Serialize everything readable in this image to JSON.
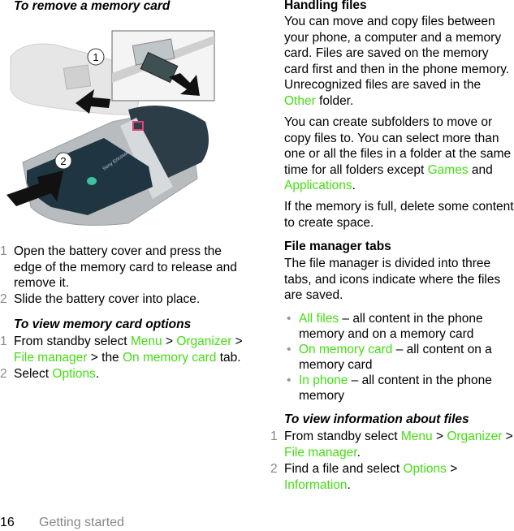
{
  "left": {
    "heading1": "To remove a memory card",
    "illustration": {
      "callout1": "1",
      "callout2": "2",
      "brand_text": "Sony Ericsson"
    },
    "steps1": [
      {
        "num": "1",
        "text": "Open the battery cover and press the edge of the memory card to release and remove it."
      },
      {
        "num": "2",
        "text": "Slide the battery cover into place."
      }
    ],
    "heading2": "To view memory card options",
    "steps2": [
      {
        "num": "1",
        "pre": "From standby select ",
        "l1": "Menu",
        "s1": " > ",
        "l2": "Organizer",
        "s2": " > ",
        "l3": "File manager",
        "s3": " > the ",
        "l4": "On memory card",
        "post": " tab."
      },
      {
        "num": "2",
        "pre": "Select ",
        "l1": "Options",
        "post": "."
      }
    ]
  },
  "right": {
    "heading1": "Handling files",
    "p1": {
      "pre": "You can move and copy files between your phone, a computer and a memory card. Files are saved on the memory card first and then in the phone memory. Unrecognized files are saved in the ",
      "link": "Other",
      "post": " folder."
    },
    "p2": {
      "pre": "You can create subfolders to move or copy files to. You can select more than one or all the files in a folder at the same time for all folders except ",
      "l1": "Games",
      "mid": " and ",
      "l2": "Applications",
      "post": "."
    },
    "p3": "If the memory is full, delete some content to create space.",
    "heading2": "File manager tabs",
    "p4": "The file manager is divided into three tabs, and icons indicate where the files are saved.",
    "bullets": [
      {
        "link": "All files",
        "text": " – all content in the phone memory and on a memory card"
      },
      {
        "link": "On memory card",
        "text": " – all content on a memory card"
      },
      {
        "link": "In phone",
        "text": " – all content in the phone memory"
      }
    ],
    "heading3": "To view information about files",
    "steps": [
      {
        "num": "1",
        "pre": "From standby select ",
        "l1": "Menu",
        "s1": " > ",
        "l2": "Organizer",
        "s2": " > ",
        "l3": "File manager",
        "post": "."
      },
      {
        "num": "2",
        "pre": "Find a file and select ",
        "l1": "Options",
        "s1": " > ",
        "l2": "Information",
        "post": "."
      }
    ]
  },
  "footer": {
    "page_number": "16",
    "section": "Getting started"
  },
  "colors": {
    "link": "#44dd11",
    "step_number": "#888888",
    "bullet": "#999999"
  }
}
